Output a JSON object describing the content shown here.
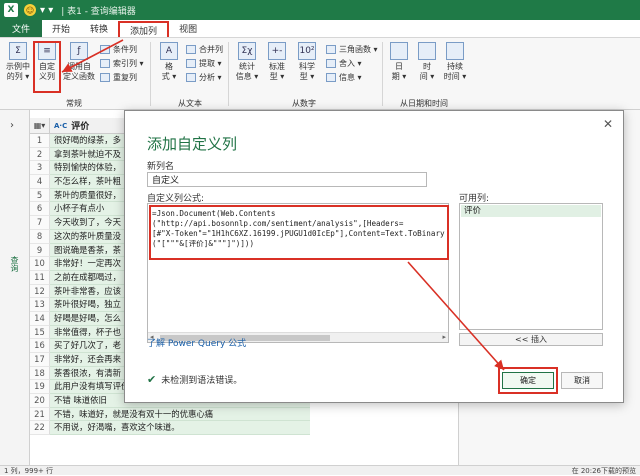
{
  "titlebar": {
    "logo": "X",
    "smile": "☺",
    "qa_symbols": "▾ ▾",
    "title": "| 表1 - 查询编辑器"
  },
  "tabs": [
    "文件",
    "开始",
    "转换",
    "添加列",
    "视图"
  ],
  "ribbon": {
    "example_col": "示例中\n的列 ▾",
    "custom_col": "自定\n义列",
    "invoke_func": "调用自\n定义函数",
    "cond_col": "条件列",
    "index_col": "索引列 ▾",
    "dup_col": "重复列",
    "format": "格\n式 ▾",
    "merge_col": "合并列",
    "extract": "提取 ▾",
    "analyze": "分析 ▾",
    "stats": "统计\n信息 ▾",
    "standard": "标准\n型 ▾",
    "scientific": "科学\n型 ▾",
    "trig": "三角函数 ▾",
    "round": "舍入 ▾",
    "info": "信息 ▾",
    "date": "日\n期 ▾",
    "time": "时\n间 ▾",
    "duration": "持续\n时间 ▾",
    "group_general": "常规",
    "group_text": "从文本",
    "group_number": "从数字",
    "group_datetime": "从日期和时间",
    "icons": {
      "example": "Σ",
      "custom": "≡",
      "invoke": "ƒ",
      "format": "A",
      "stats": "Σχ",
      "standard": "+-",
      "scientific": "10²"
    }
  },
  "leftpane": {
    "chevron": "›",
    "query_label": "查询"
  },
  "grid": {
    "column_header": "评价",
    "type_icon": "A·C",
    "selector_icon": "▦▾",
    "rows": [
      {
        "n": "1",
        "text": "很好喝的绿茶，多"
      },
      {
        "n": "2",
        "text": "拿到茶叶就迫不及"
      },
      {
        "n": "3",
        "text": "特别愉快的体验，"
      },
      {
        "n": "4",
        "text": "不怎么样，茶叶粗"
      },
      {
        "n": "5",
        "text": "茶叶的质量很好，"
      },
      {
        "n": "6",
        "text": "小杯子有点小"
      },
      {
        "n": "7",
        "text": "今天收到了，今天"
      },
      {
        "n": "8",
        "text": "这次的茶叶质量没"
      },
      {
        "n": "9",
        "text": "图说确是香茶，茶"
      },
      {
        "n": "10",
        "text": "非常好！一定再次"
      },
      {
        "n": "11",
        "text": "之前在成都喝过，"
      },
      {
        "n": "12",
        "text": "茶叶非常香，应该"
      },
      {
        "n": "13",
        "text": "茶叶很好喝，独立"
      },
      {
        "n": "14",
        "text": "好喝是好喝，怎么"
      },
      {
        "n": "15",
        "text": "非常值得，杯子也"
      },
      {
        "n": "16",
        "text": "买了好几次了，老"
      },
      {
        "n": "17",
        "text": "非常好，还会再来"
      },
      {
        "n": "18",
        "text": "茶香很浓，有清新"
      },
      {
        "n": "19",
        "text": "此用户没有填写评价。"
      },
      {
        "n": "20",
        "text": "不错 味道依旧"
      },
      {
        "n": "21",
        "text": "不错，味道好，就是没有双十一的优惠心痛"
      },
      {
        "n": "22",
        "text": "不用说，好渴嘴，喜欢这个味道。"
      }
    ]
  },
  "status": {
    "left": "1 列，999+ 行",
    "right": "在 20:26下载的预览"
  },
  "dialog": {
    "title": "添加自定义列",
    "close": "✕",
    "new_col_label": "新列名",
    "new_col_value": "自定义",
    "formula_label": "自定义列公式:",
    "formula": "=Json.Document(Web.Contents\n(\"http://api.bosonnlp.com/sentiment/analysis\",[Headers=\n[#\"X-Token\"=\"1H1hC6XZ.16199.jPUGU1d0IcEp\"],Content=Text.ToBinary\n(\"[\"\"\"&[评价]&\"\"\"]\")]))",
    "available_label": "可用列:",
    "available": [
      "评价"
    ],
    "insert": "<< 插入",
    "link": "了解 Power Query 公式",
    "no_error": "未检测到语法错误。",
    "ok": "确定",
    "cancel": "取消",
    "scroll_left": "◂",
    "scroll_right": "▸",
    "check_icon": "✔"
  }
}
